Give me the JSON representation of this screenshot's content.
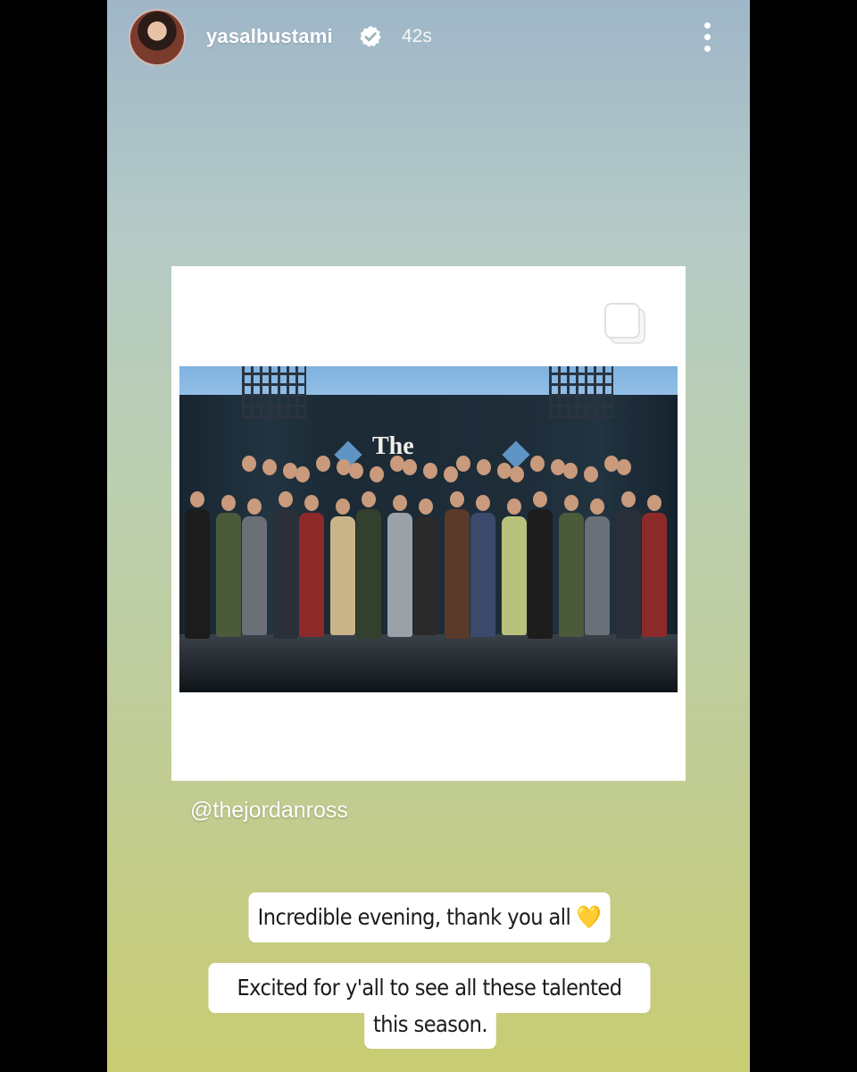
{
  "story": {
    "username": "yasalbustami",
    "timestamp": "42s",
    "verified": true,
    "more_icon": "more-vertical-icon"
  },
  "post": {
    "backdrop_text": "The",
    "multi_photo_icon": "carousel-icon"
  },
  "mention": "@thejordanross",
  "captions": {
    "line1": "Incredible evening, thank you all 💛",
    "line2a": "Excited for y'all to see all these talented folks",
    "line2b": "this season."
  },
  "colors": {
    "gradient_top": "#9fb6c8",
    "gradient_bottom": "#c8cc72",
    "verified_badge": "#ffffff"
  }
}
